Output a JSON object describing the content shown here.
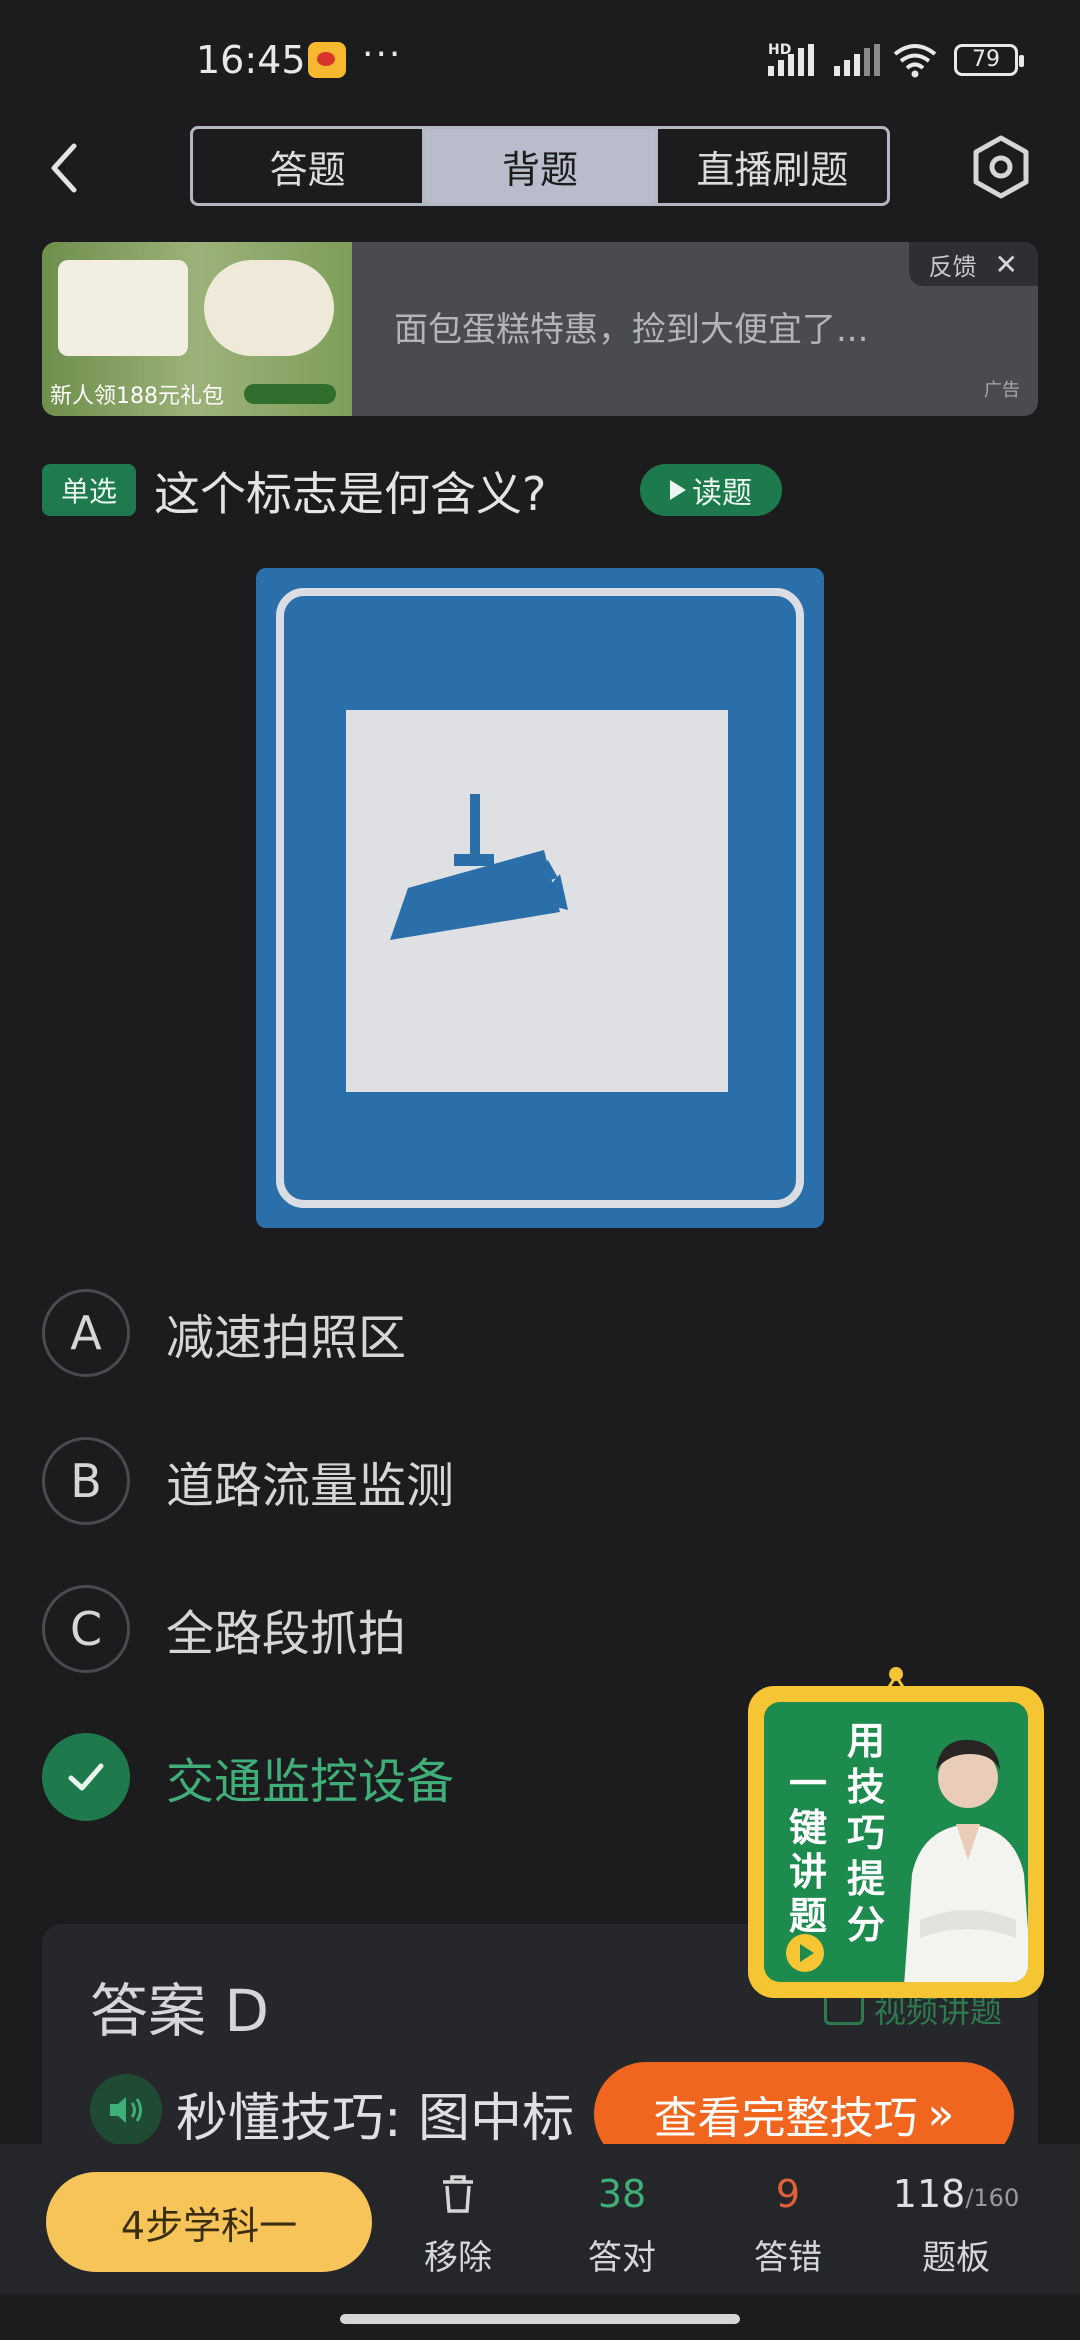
{
  "status_bar": {
    "time": "16:45",
    "more": "···",
    "network_label": "HD",
    "battery": "79"
  },
  "nav": {
    "tabs": [
      {
        "label": "答题",
        "active": false
      },
      {
        "label": "背题",
        "active": true
      },
      {
        "label": "直播刷题",
        "active": false
      }
    ],
    "icons": {
      "back": "chevron-left-icon",
      "settings": "gear-icon"
    }
  },
  "ad": {
    "text": "面包蛋糕特惠，捡到大便宜了...",
    "image_caption": "新人领188元礼包",
    "feedback_label": "反馈",
    "close_glyph": "✕",
    "ad_label": "广告"
  },
  "question": {
    "type": "单选",
    "text": "这个标志是何含义?",
    "read_label": "读题"
  },
  "options": [
    {
      "letter": "A",
      "text": "减速拍照区",
      "correct": false
    },
    {
      "letter": "B",
      "text": "道路流量监测",
      "correct": false
    },
    {
      "letter": "C",
      "text": "全路段抓拍",
      "correct": false
    },
    {
      "letter": "D",
      "text": "交通监控设备",
      "correct": true
    }
  ],
  "answer": {
    "label": "答案  D",
    "video_link": "视频讲题",
    "tip_text": "秒懂技巧: 图中标",
    "full_tip_button": "查看完整技巧",
    "full_tip_arrow": "»"
  },
  "promo": {
    "col1": "一键讲题",
    "col2": "用技巧提分"
  },
  "bottom_bar": {
    "study_button": "4步学科一",
    "remove_label": "移除",
    "correct_count": "38",
    "correct_label": "答对",
    "wrong_count": "9",
    "wrong_label": "答错",
    "board_current": "118",
    "board_total": "/160",
    "board_label": "题板"
  },
  "colors": {
    "accent_green": "#1e7a4c",
    "correct_text": "#3fae78",
    "wrong_text": "#e0603a",
    "study_button": "#f6c458",
    "tip_button": "#f0661f",
    "sign_blue": "#2a6faa"
  }
}
